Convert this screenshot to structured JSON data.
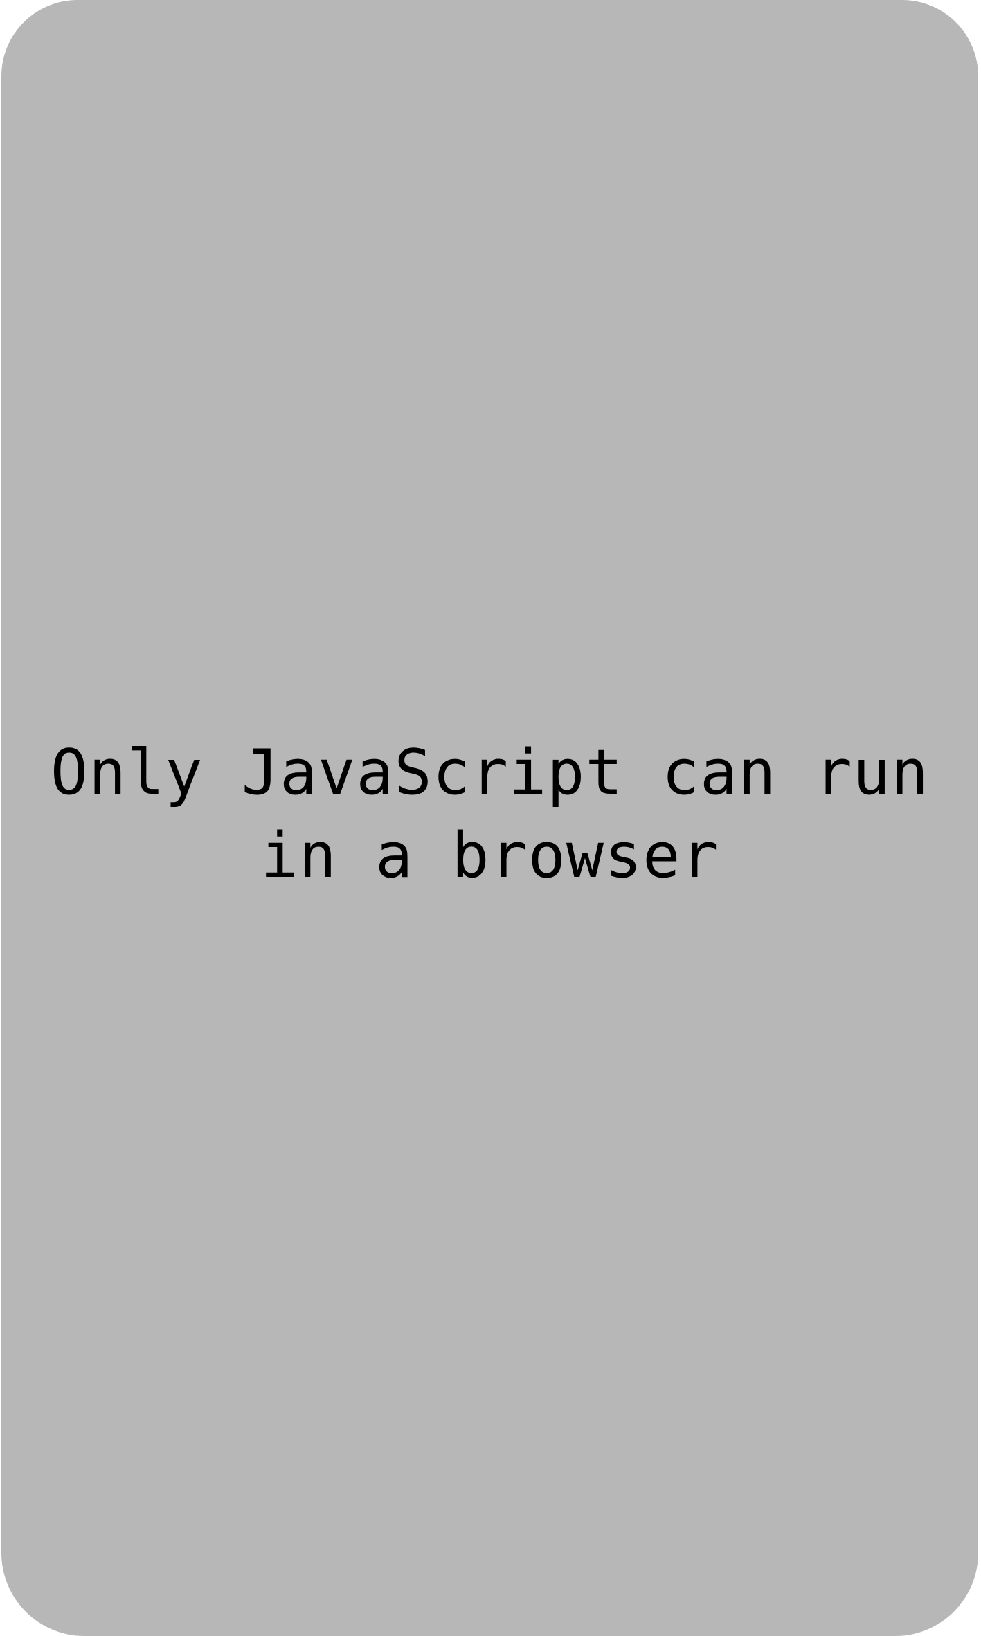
{
  "card": {
    "background_color": "#b7b7b7",
    "message": "Only JavaScript can run\nin a browser"
  }
}
